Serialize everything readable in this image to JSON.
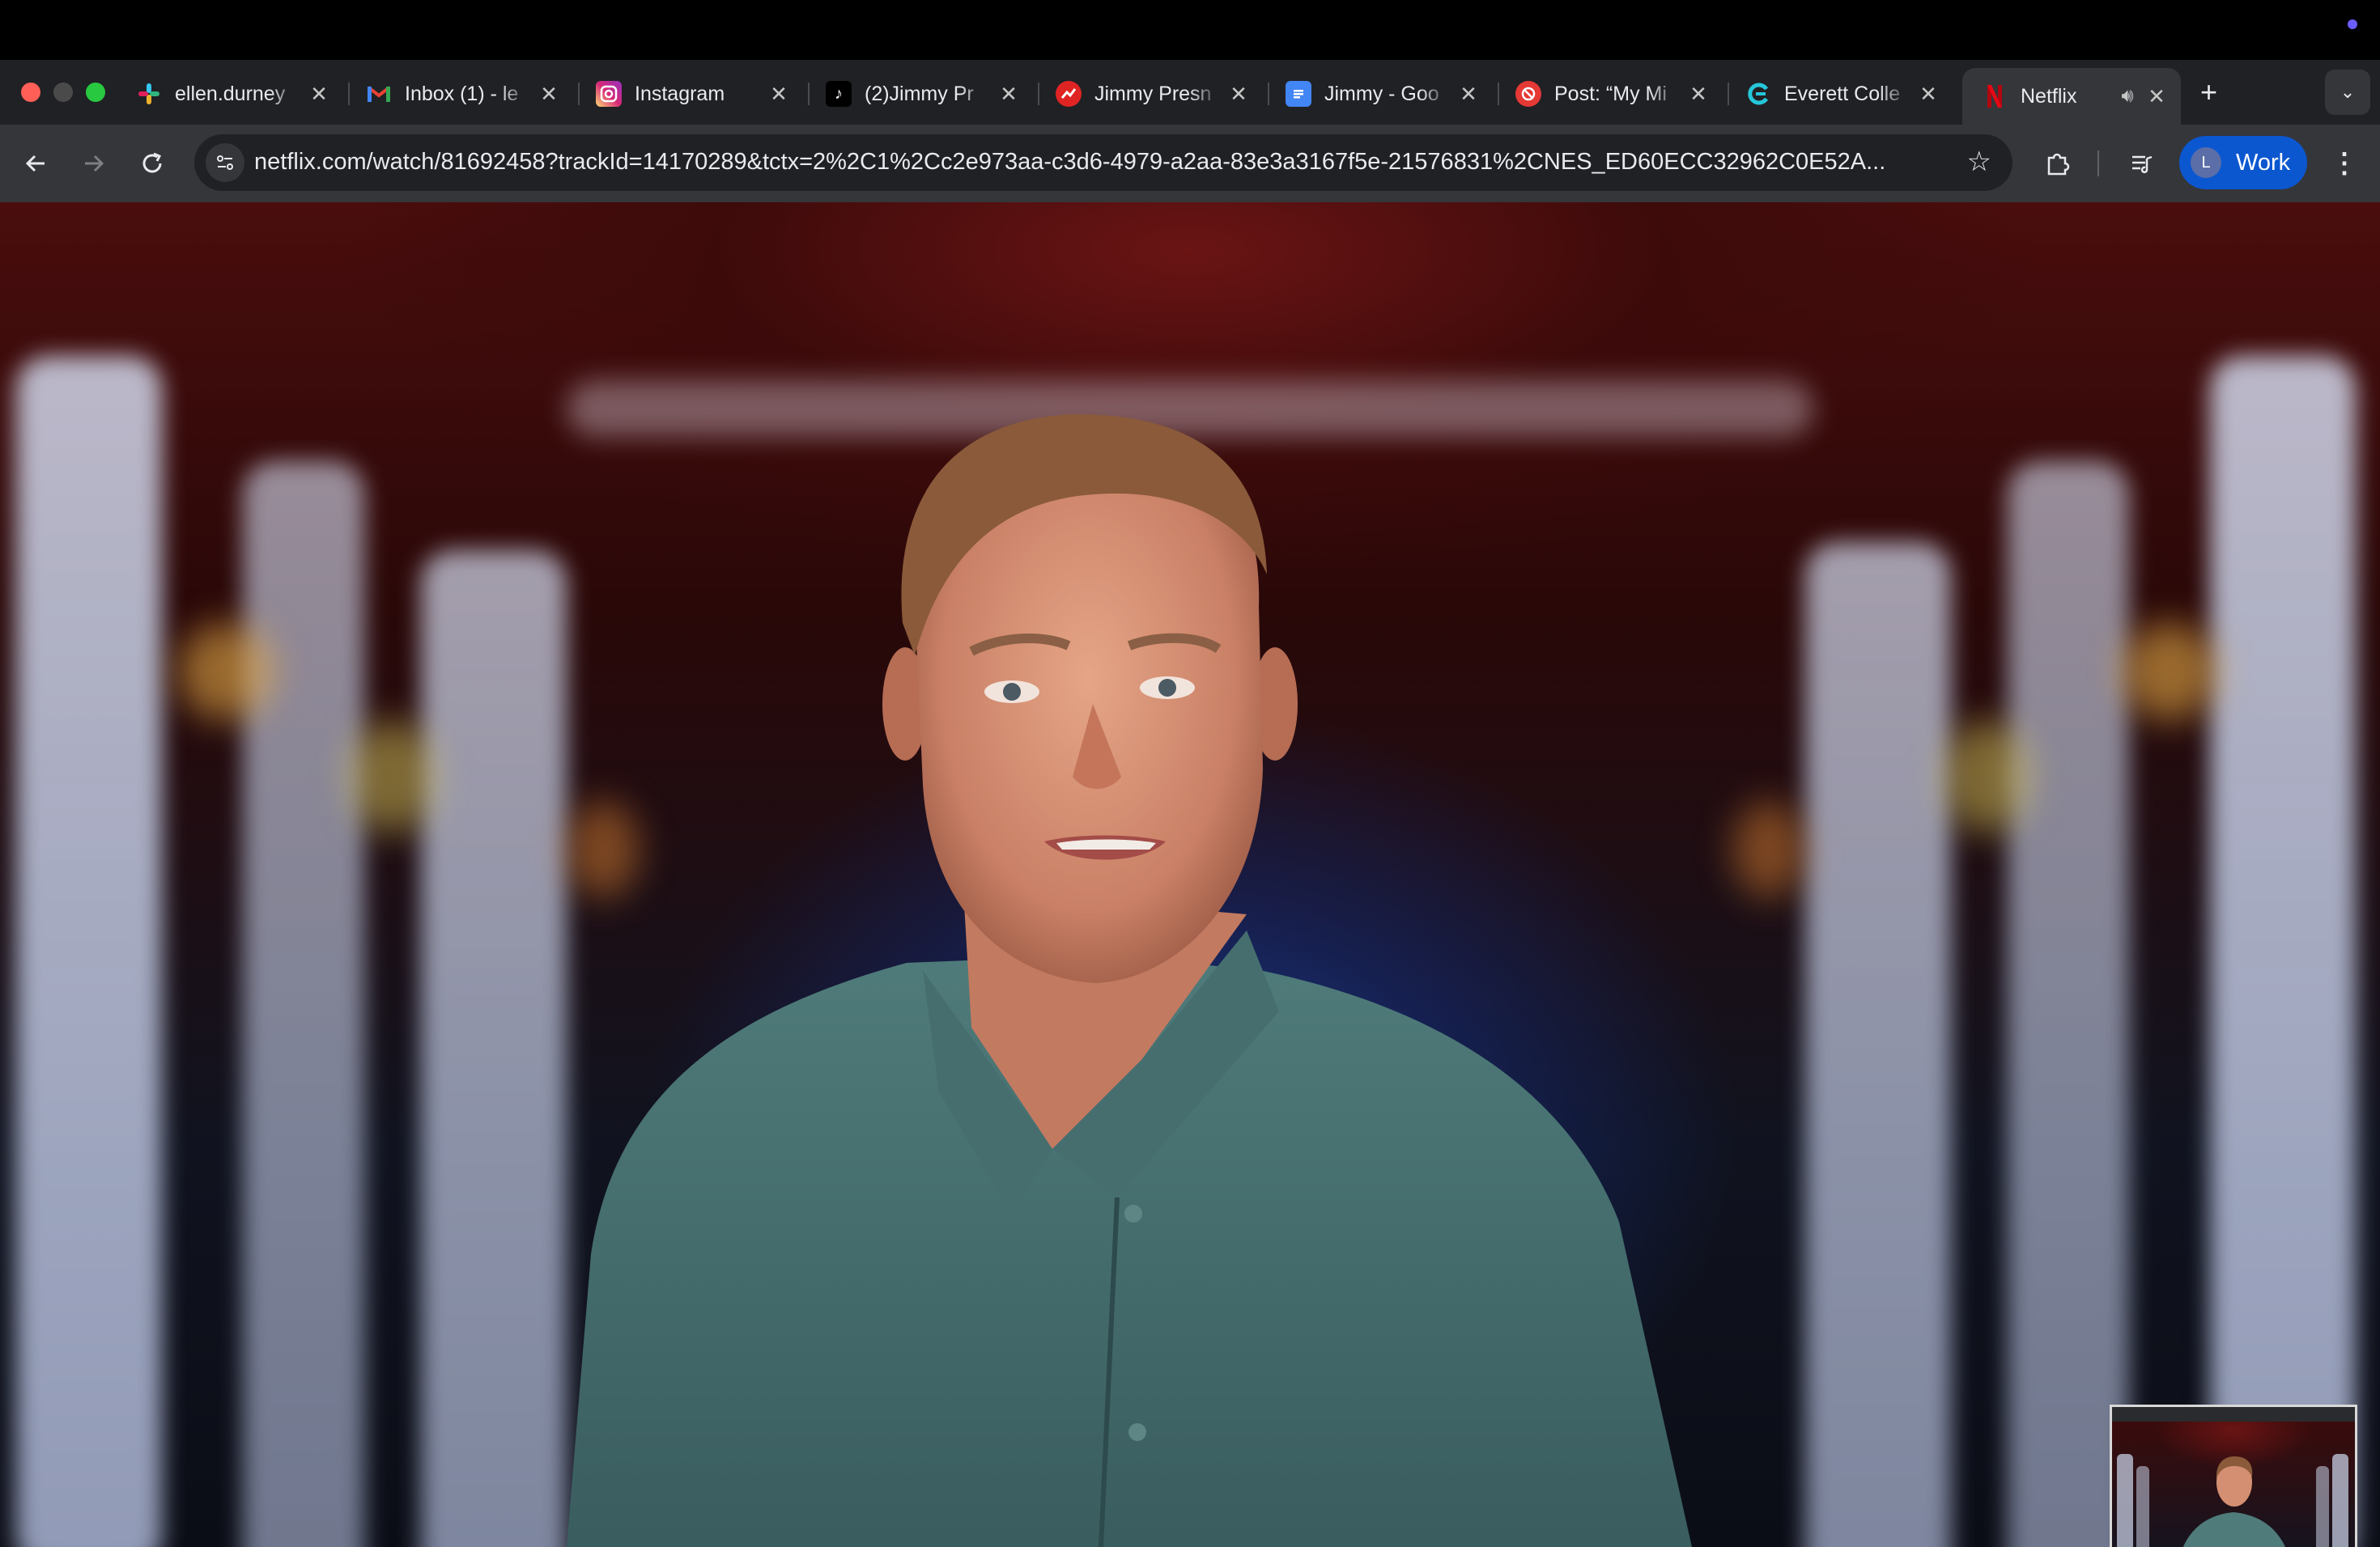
{
  "browser": {
    "tabs": [
      {
        "title": "ellen.durney",
        "favicon": "slack-icon",
        "active": false
      },
      {
        "title": "Inbox (1) - le",
        "favicon": "gmail-icon",
        "active": false
      },
      {
        "title": "Instagram",
        "favicon": "instagram-icon",
        "active": false
      },
      {
        "title": "(2)Jimmy Pr",
        "favicon": "tiktok-icon",
        "active": false
      },
      {
        "title": "Jimmy Presn",
        "favicon": "trending-icon",
        "active": false
      },
      {
        "title": "Jimmy - Goo",
        "favicon": "google-docs-icon",
        "active": false
      },
      {
        "title": "Post: “My Mi",
        "favicon": "no-entry-icon",
        "active": false
      },
      {
        "title": "Everett Colle",
        "favicon": "everett-icon",
        "active": false
      },
      {
        "title": "Netflix",
        "favicon": "netflix-icon",
        "active": true,
        "audio": "speaker-icon"
      }
    ],
    "url": "netflix.com/watch/81692458?trackId=14170289&tctx=2%2C1%2Cc2e973aa-c3d6-4979-a2aa-83e3a3167f5e-21576831%2CNES_ED60ECC32962C0E52A...",
    "profile": {
      "initial": "L",
      "label": "Work"
    }
  },
  "colors": {
    "tab_bar": "#202124",
    "toolbar": "#35363a",
    "profile_chip": "#0b57d0",
    "netflix_red": "#e50914"
  }
}
